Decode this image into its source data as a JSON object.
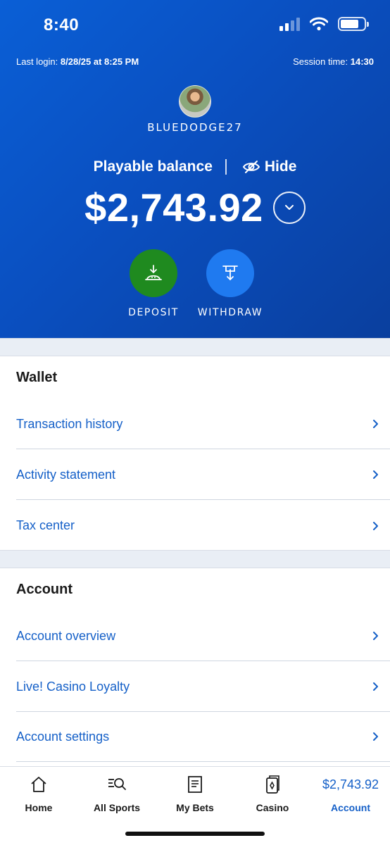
{
  "status_bar": {
    "time": "8:40"
  },
  "header": {
    "last_login_label": "Last login:",
    "last_login_value": "8/28/25 at 8:25 PM",
    "session_label": "Session time:",
    "session_value": "14:30",
    "username": "BLUEDODGE27",
    "balance_label": "Playable balance",
    "hide_label": "Hide",
    "balance_amount": "$2,743.92",
    "deposit_label": "DEPOSIT",
    "withdraw_label": "WITHDRAW"
  },
  "wallet": {
    "title": "Wallet",
    "items": [
      "Transaction history",
      "Activity statement",
      "Tax center"
    ]
  },
  "account": {
    "title": "Account",
    "items": [
      "Account overview",
      "Live! Casino Loyalty",
      "Account settings"
    ]
  },
  "tabbar": {
    "home": "Home",
    "sports": "All Sports",
    "bets": "My Bets",
    "casino": "Casino",
    "account_balance": "$2,743.92",
    "account": "Account"
  },
  "colors": {
    "brand_blue": "#0a4fc0",
    "link_blue": "#1560c8",
    "deposit_green": "#1f8a1f",
    "withdraw_blue": "#1f7af0"
  }
}
